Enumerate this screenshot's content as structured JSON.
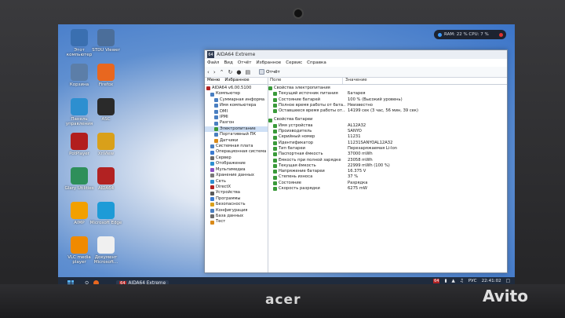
{
  "device": {
    "brand": "acer",
    "watermark": "Avito"
  },
  "desktop_icons": [
    {
      "label": "Этот компьютер",
      "icon": "computer-icon",
      "color": "#3a6fb0"
    },
    {
      "label": "STDU Viewer",
      "icon": "stdu-icon",
      "color": "#4b6e9a"
    },
    {
      "label": "Корзина",
      "icon": "recycle-bin-icon",
      "color": "#5c7ea8"
    },
    {
      "label": "Firefox",
      "icon": "firefox-icon",
      "color": "#e8671f"
    },
    {
      "label": "Панель управления",
      "icon": "control-panel-icon",
      "color": "#2d8fd0"
    },
    {
      "label": "ASC",
      "icon": "asc-icon",
      "color": "#2a2a2a"
    },
    {
      "label": "PotPlayer",
      "icon": "potplayer-icon",
      "color": "#b21e1e"
    },
    {
      "label": "XnView",
      "icon": "xnview-icon",
      "color": "#d9a01a"
    },
    {
      "label": "Glary Utilities",
      "icon": "glary-icon",
      "color": "#2e8f5a"
    },
    {
      "label": "AIDA64",
      "icon": "aida64-icon",
      "color": "#b22222"
    },
    {
      "label": "AIMP",
      "icon": "aimp-icon",
      "color": "#f2a000"
    },
    {
      "label": "Microsoft Edge",
      "icon": "edge-icon",
      "color": "#1e9bd7"
    },
    {
      "label": "VLC media player",
      "icon": "vlc-icon",
      "color": "#f08a00"
    },
    {
      "label": "Документ Microsoft...",
      "icon": "document-icon",
      "color": "#f0f0f0"
    }
  ],
  "tray_top": {
    "text": "RAM: 22 %  CPU: 7 %"
  },
  "window": {
    "badge": "64",
    "title": "AIDA64 Extreme",
    "menu": [
      "Файл",
      "Вид",
      "Отчёт",
      "Избранное",
      "Сервис",
      "Справка"
    ],
    "toolbar_report": "Отчёт",
    "tabs": [
      "Меню",
      "Избранное"
    ],
    "tree": [
      {
        "label": "AIDA64 v6.00.5100",
        "level": 0,
        "color": "#b22222"
      },
      {
        "label": "Компьютер",
        "level": 1,
        "color": "#4a7fc1"
      },
      {
        "label": "Суммарная информа",
        "level": 2,
        "color": "#4a7fc1"
      },
      {
        "label": "Имя компьютера",
        "level": 2,
        "color": "#4a7fc1"
      },
      {
        "label": "DMI",
        "level": 2,
        "color": "#4a7fc1"
      },
      {
        "label": "IPMI",
        "level": 2,
        "color": "#4a7fc1"
      },
      {
        "label": "Разгон",
        "level": 2,
        "color": "#4a7fc1"
      },
      {
        "label": "Электропитание",
        "level": 2,
        "color": "#3a9a3a",
        "selected": true
      },
      {
        "label": "Портативный ПК",
        "level": 2,
        "color": "#4a7fc1"
      },
      {
        "label": "Датчики",
        "level": 2,
        "color": "#d98a1a"
      },
      {
        "label": "Системная плата",
        "level": 1,
        "color": "#4a7fc1"
      },
      {
        "label": "Операционная система",
        "level": 1,
        "color": "#3a7ad0"
      },
      {
        "label": "Сервер",
        "level": 1,
        "color": "#6a6a6a"
      },
      {
        "label": "Отображение",
        "level": 1,
        "color": "#2d8fd0"
      },
      {
        "label": "Мультимедиа",
        "level": 1,
        "color": "#8a4fc1"
      },
      {
        "label": "Хранение данных",
        "level": 1,
        "color": "#777777"
      },
      {
        "label": "Сеть",
        "level": 1,
        "color": "#2d8fd0"
      },
      {
        "label": "DirectX",
        "level": 1,
        "color": "#b22222"
      },
      {
        "label": "Устройства",
        "level": 1,
        "color": "#5a5a5a"
      },
      {
        "label": "Программы",
        "level": 1,
        "color": "#3a7ad0"
      },
      {
        "label": "Безопасность",
        "level": 1,
        "color": "#d9a01a"
      },
      {
        "label": "Конфигурация",
        "level": 1,
        "color": "#4a7fc1"
      },
      {
        "label": "База данных",
        "level": 1,
        "color": "#6a6a6a"
      },
      {
        "label": "Тест",
        "level": 1,
        "color": "#d98a1a"
      }
    ],
    "columns": [
      "Поле",
      "Значение"
    ],
    "sections": [
      {
        "title": "Свойства электропитания",
        "rows": [
          {
            "field": "Текущий источник питания",
            "value": "Батарея"
          },
          {
            "field": "Состояние батарей",
            "value": "100 % (Высокий уровень)"
          },
          {
            "field": "Полное время работы от бата...",
            "value": "Неизвестно"
          },
          {
            "field": "Оставшееся время работы от...",
            "value": "14199 сек (3 час, 56 мин, 39 сек)"
          }
        ]
      },
      {
        "title": "Свойства батареи",
        "rows": [
          {
            "field": "Имя устройства",
            "value": "AL12A32"
          },
          {
            "field": "Производитель",
            "value": "SANYO"
          },
          {
            "field": "Серийный номер",
            "value": "11231"
          },
          {
            "field": "Идентификатор",
            "value": "11231SANYOAL12A32"
          },
          {
            "field": "Тип батареи",
            "value": "Перезаряжаемая Li-Ion"
          },
          {
            "field": "Паспортная ёмкость",
            "value": "37000 mWh"
          },
          {
            "field": "Ёмкость при полной зарядке",
            "value": "23058 mWh"
          },
          {
            "field": "Текущая ёмкость",
            "value": "22999 mWh  (100 %)"
          },
          {
            "field": "Напряжение батареи",
            "value": "16.375 V"
          },
          {
            "field": "Степень износа",
            "value": "37 %"
          },
          {
            "field": "Состояние",
            "value": "Разрядка"
          },
          {
            "field": "Скорость разрядки",
            "value": "6275 mW"
          }
        ]
      }
    ]
  },
  "taskbar": {
    "app_badge": "64",
    "app_label": "AIDA64 Extreme",
    "tray_badge": "64",
    "language": "РУС",
    "time": "22:41:02"
  }
}
